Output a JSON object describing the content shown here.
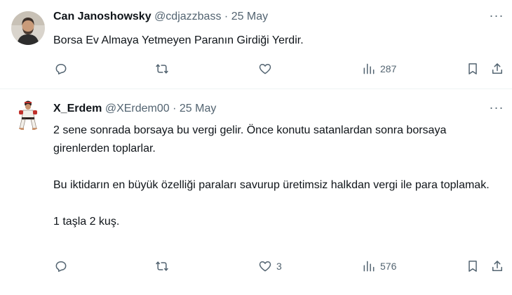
{
  "tweets": [
    {
      "name": "Can Janoshowsky",
      "handle": "@cdjazzbass",
      "separator": "·",
      "date": "25 May",
      "paragraphs": [
        "Borsa Ev Almaya Yetmeyen Paranın Girdiği Yerdir."
      ],
      "actions": {
        "reply": "",
        "retweet": "",
        "like": "",
        "views": "287"
      }
    },
    {
      "name": "X_Erdem",
      "handle": "@XErdem00",
      "separator": "·",
      "date": "25 May",
      "paragraphs": [
        "2 sene sonrada borsaya bu vergi gelir. Önce konutu satanlardan sonra borsaya girenlerden toplarlar.",
        "Bu iktidarın en büyük özelliği paraları savurup üretimsiz halkdan vergi ile para toplamak.",
        "1 taşla 2 kuş."
      ],
      "actions": {
        "reply": "",
        "retweet": "",
        "like": "3",
        "views": "576"
      }
    }
  ],
  "more_label": "···",
  "icons": [
    "reply-icon",
    "retweet-icon",
    "like-icon",
    "views-icon",
    "bookmark-icon",
    "share-icon"
  ],
  "colors": {
    "text": "#0f1419",
    "secondary": "#536471",
    "divider": "#eff3f4"
  }
}
